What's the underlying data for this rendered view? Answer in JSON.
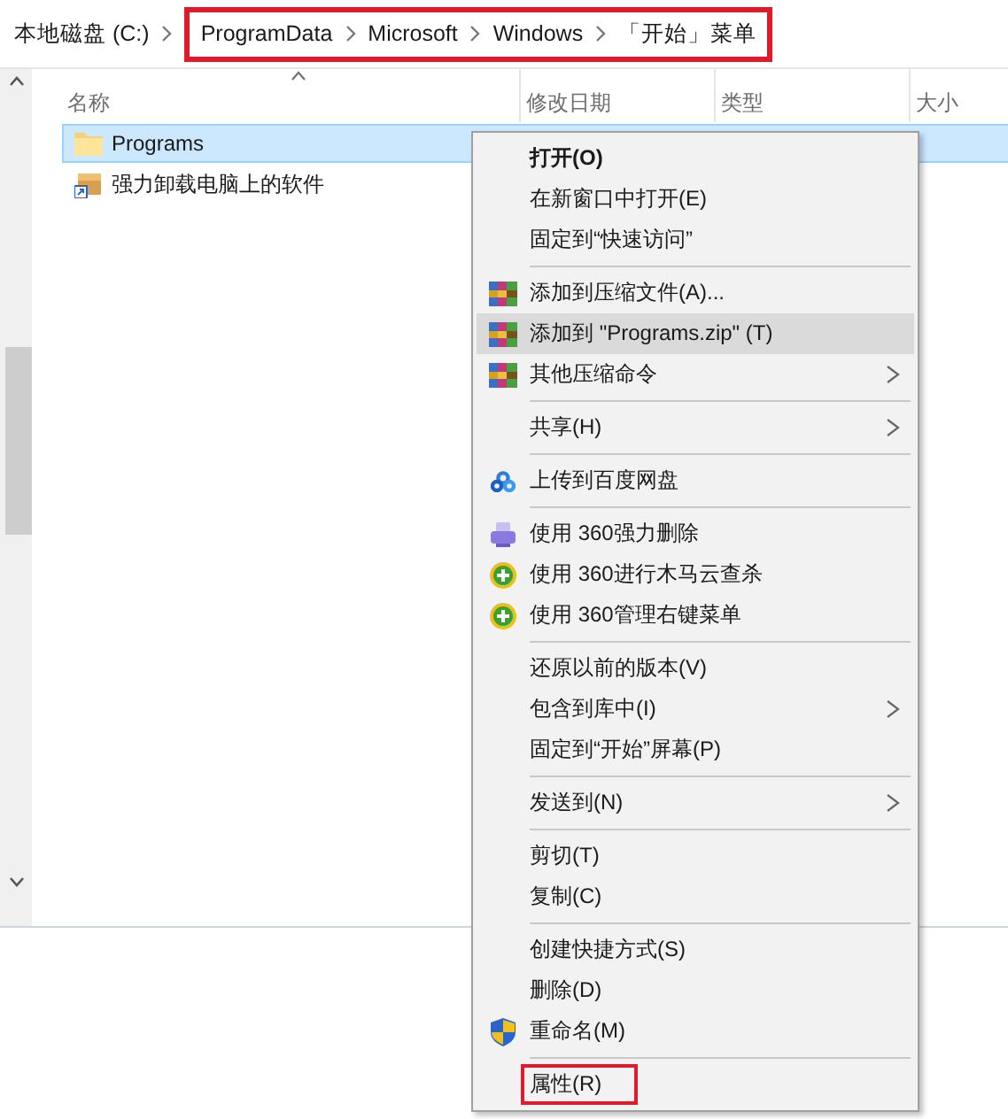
{
  "address_bar": {
    "root": "本地磁盘 (C:)",
    "segments": [
      "ProgramData",
      "Microsoft",
      "Windows",
      "「开始」菜单"
    ],
    "annotated": true
  },
  "columns": [
    {
      "label": "名称",
      "sorted": true
    },
    {
      "label": "修改日期",
      "sorted": false
    },
    {
      "label": "类型",
      "sorted": false
    },
    {
      "label": "大小",
      "sorted": false
    }
  ],
  "files": [
    {
      "name": "Programs",
      "kind": "folder",
      "selected": true
    },
    {
      "name": "强力卸载电脑上的软件",
      "kind": "shortcut",
      "selected": false
    }
  ],
  "context_menu": {
    "sections": [
      [
        {
          "label": "打开(O)",
          "bold": true,
          "selected": false
        },
        {
          "label": "在新窗口中打开(E)",
          "selected": false
        },
        {
          "label": "固定到“快速访问”",
          "selected": false
        }
      ],
      [
        {
          "label": "添加到压缩文件(A)...",
          "kind": "archive",
          "selected": false
        },
        {
          "label": "添加到 \"Programs.zip\" (T)",
          "kind": "archive",
          "selected": true
        },
        {
          "label": "其他压缩命令",
          "kind": "archive",
          "submenu": true,
          "selected": false
        }
      ],
      [
        {
          "label": "共享(H)",
          "submenu": true,
          "selected": false
        }
      ],
      [
        {
          "label": "上传到百度网盘",
          "kind": "cloud",
          "selected": false
        }
      ],
      [
        {
          "label": "使用 360强力删除",
          "kind": "shredder",
          "selected": false
        },
        {
          "label": "使用 360进行木马云查杀",
          "kind": "plus-circle",
          "selected": false
        },
        {
          "label": "使用 360管理右键菜单",
          "kind": "plus-circle",
          "selected": false
        }
      ],
      [
        {
          "label": "还原以前的版本(V)",
          "selected": false
        },
        {
          "label": "包含到库中(I)",
          "submenu": true,
          "selected": false
        },
        {
          "label": "固定到“开始”屏幕(P)",
          "selected": false
        }
      ],
      [
        {
          "label": "发送到(N)",
          "submenu": true,
          "selected": false
        }
      ],
      [
        {
          "label": "剪切(T)",
          "selected": false
        },
        {
          "label": "复制(C)",
          "selected": false
        }
      ],
      [
        {
          "label": "创建快捷方式(S)",
          "selected": false
        },
        {
          "label": "删除(D)",
          "selected": false
        },
        {
          "label": "重命名(M)",
          "kind": "shield",
          "selected": false
        }
      ],
      [
        {
          "label": "属性(R)",
          "annotated": true,
          "selected": false
        }
      ]
    ]
  }
}
